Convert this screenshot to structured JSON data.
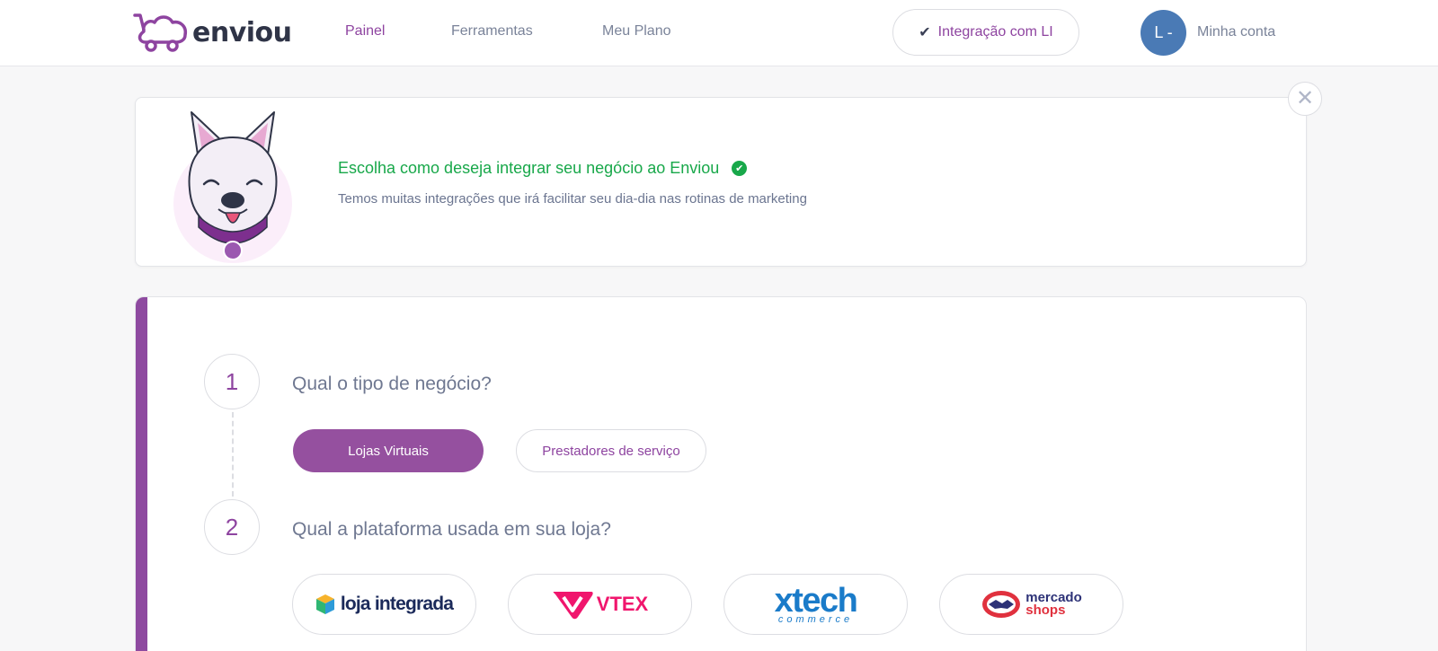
{
  "header": {
    "brand": "enviou",
    "nav": {
      "painel": "Painel",
      "ferramentas": "Ferramentas",
      "meu_plano": "Meu Plano"
    },
    "integration_button": "Integração com LI",
    "avatar_initials": "L -",
    "account_label": "Minha conta"
  },
  "banner": {
    "title": "Escolha como deseja integrar seu negócio ao Enviou",
    "subtitle": "Temos muitas integrações que irá facilitar seu dia-dia nas rotinas de marketing"
  },
  "wizard": {
    "steps": [
      {
        "number": "1",
        "question": "Qual o tipo de negócio?",
        "options": [
          "Lojas Virtuais",
          "Prestadores de serviço"
        ],
        "selected": "Lojas Virtuais"
      },
      {
        "number": "2",
        "question": "Qual a plataforma usada em sua loja?",
        "platforms": {
          "loja_integrada": "loja integrada",
          "vtex": "VTEX",
          "xtech": "xtech",
          "xtech_sub": "commerce",
          "mercado_top": "mercado",
          "mercado_bottom": "shops"
        }
      }
    ]
  },
  "colors": {
    "brand_purple": "#8e44a0",
    "success_green": "#18a84a",
    "avatar_blue": "#4a7ab5"
  },
  "icons": [
    "car-logo-icon",
    "check-icon",
    "check-circle-icon",
    "close-icon",
    "dog-mascot-icon"
  ]
}
